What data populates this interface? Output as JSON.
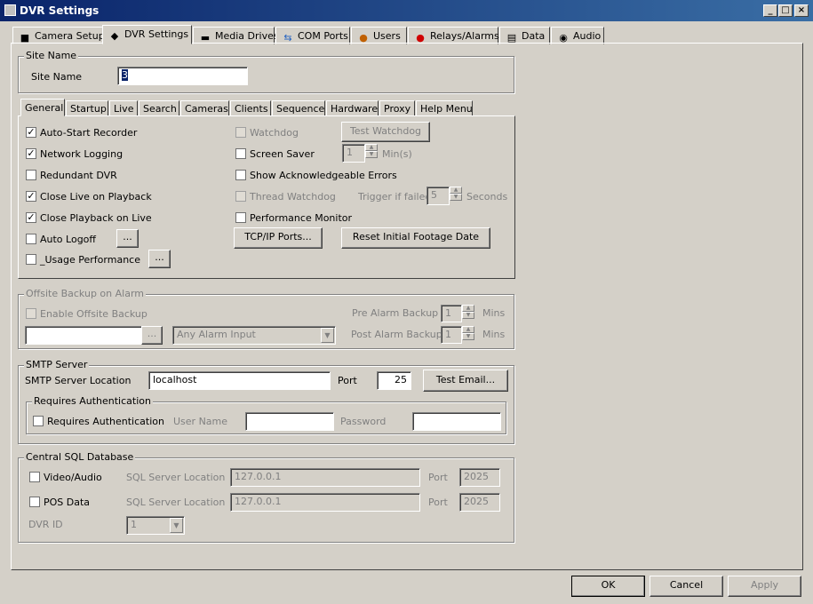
{
  "window": {
    "title": "DVR Settings"
  },
  "main_tabs": [
    {
      "label": "Camera Setup",
      "icon": "camera-icon"
    },
    {
      "label": "DVR Settings",
      "icon": "dvr-icon"
    },
    {
      "label": "Media Drives",
      "icon": "drive-icon"
    },
    {
      "label": "COM Ports",
      "icon": "com-port-icon"
    },
    {
      "label": "Users",
      "icon": "users-icon"
    },
    {
      "label": "Relays/Alarms",
      "icon": "alarm-icon"
    },
    {
      "label": "Data",
      "icon": "data-icon"
    },
    {
      "label": "Audio",
      "icon": "audio-icon"
    }
  ],
  "site_name": {
    "group_label": "Site Name",
    "label": "Site Name",
    "value": "3"
  },
  "sub_tabs": [
    "General",
    "Startup",
    "Live",
    "Search",
    "Cameras",
    "Clients",
    "Sequence",
    "Hardware",
    "Proxy",
    "Help Menu"
  ],
  "general": {
    "auto_start": {
      "label": "Auto-Start Recorder",
      "checked": true
    },
    "network_logging": {
      "label": "Network Logging",
      "checked": true
    },
    "redundant": {
      "label": "Redundant DVR",
      "checked": false
    },
    "close_live": {
      "label": "Close Live on Playback",
      "checked": true
    },
    "close_playback": {
      "label": "Close Playback on Live",
      "checked": true
    },
    "auto_logoff": {
      "label": "Auto Logoff",
      "checked": false,
      "button": "..."
    },
    "usage_perf": {
      "label": "_Usage Performance",
      "checked": false,
      "button": "..."
    },
    "watchdog": {
      "label": "Watchdog",
      "checked": false
    },
    "test_watchdog": "Test Watchdog",
    "screen_saver": {
      "label": "Screen Saver",
      "checked": false,
      "value": "1",
      "unit": "Min(s)"
    },
    "show_ack": {
      "label": "Show Acknowledgeable Errors",
      "checked": false
    },
    "thread_watchdog": {
      "label": "Thread Watchdog",
      "checked": false
    },
    "trigger": {
      "label": "Trigger if failed",
      "value": "5",
      "unit": "Seconds"
    },
    "perf_monitor": {
      "label": "Performance Monitor",
      "checked": false
    },
    "tcpip_button": "TCP/IP Ports...",
    "reset_button": "Reset Initial Footage Date"
  },
  "offsite": {
    "group_label": "Offsite Backup on Alarm",
    "enable": {
      "label": "Enable Offsite Backup",
      "checked": false
    },
    "path_value": "",
    "browse": "...",
    "alarm_select": "Any Alarm Input",
    "pre": {
      "label": "Pre Alarm Backup",
      "value": "1",
      "unit": "Mins"
    },
    "post": {
      "label": "Post Alarm Backup",
      "value": "1",
      "unit": "Mins"
    }
  },
  "smtp": {
    "group_label": "SMTP Server",
    "location_label": "SMTP Server Location",
    "location_value": "localhost",
    "port_label": "Port",
    "port_value": "25",
    "test_button": "Test Email...",
    "auth_group_label": "Requires Authentication",
    "auth_checkbox": {
      "label": "Requires Authentication",
      "checked": false
    },
    "user_label": "User Name",
    "user_value": "",
    "password_label": "Password",
    "password_value": ""
  },
  "sql": {
    "group_label": "Central SQL Database",
    "video": {
      "label": "Video/Audio",
      "checked": false,
      "loc_label": "SQL Server Location",
      "loc_value": "127.0.0.1",
      "port_label": "Port",
      "port_value": "2025"
    },
    "pos": {
      "label": "POS Data",
      "checked": false,
      "loc_label": "SQL Server Location",
      "loc_value": "127.0.0.1",
      "port_label": "Port",
      "port_value": "2025"
    },
    "dvr_id_label": "DVR ID",
    "dvr_id_value": "1"
  },
  "footer": {
    "ok": "OK",
    "cancel": "Cancel",
    "apply": "Apply"
  }
}
